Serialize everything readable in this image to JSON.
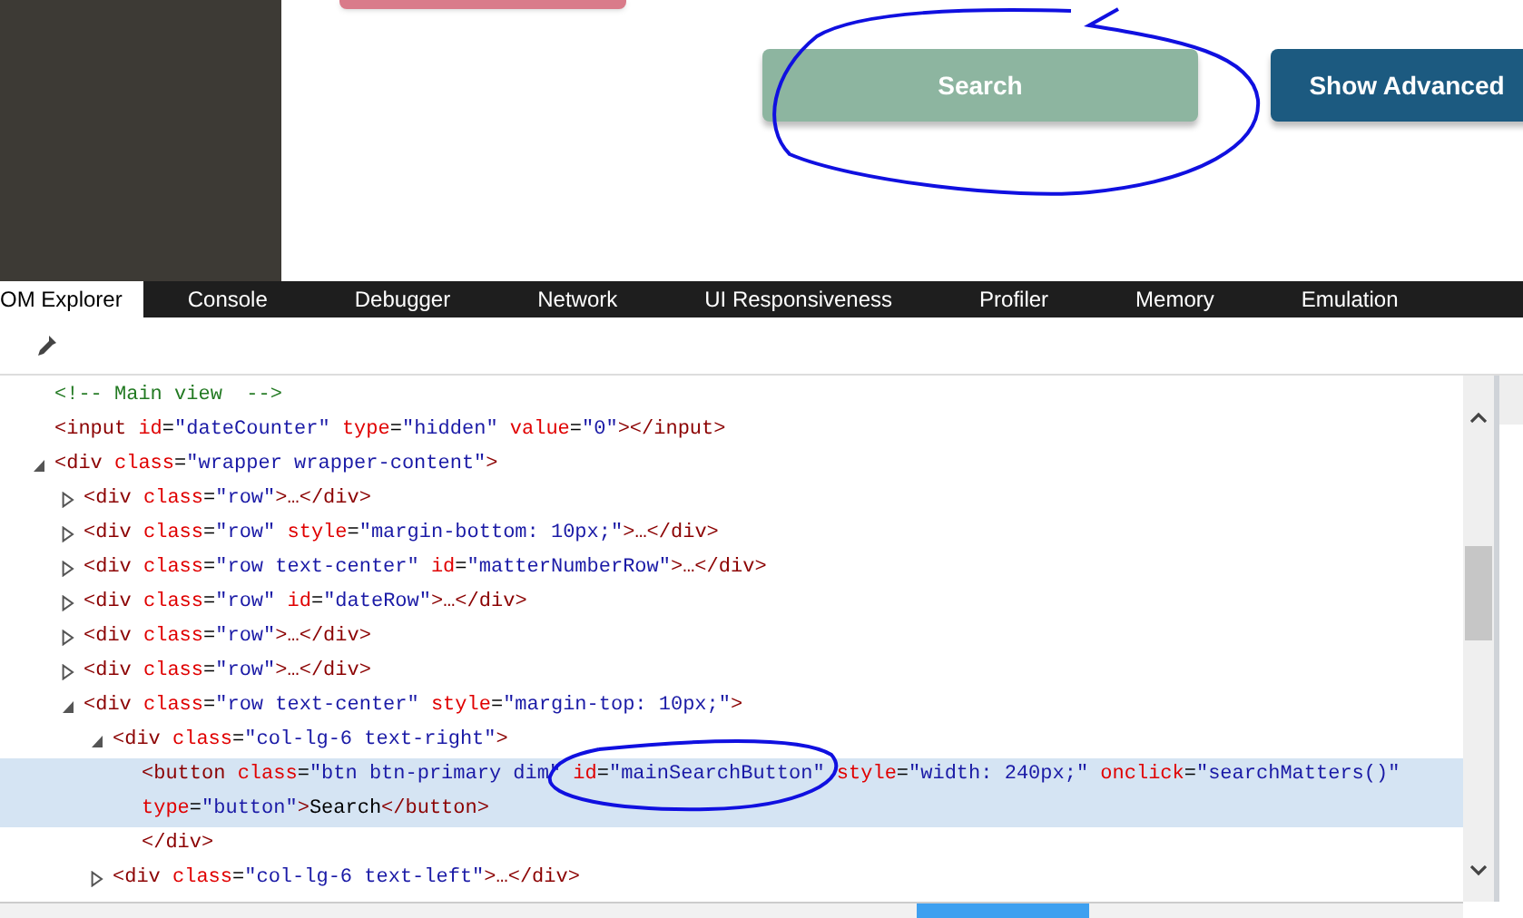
{
  "page": {
    "buttons": [
      {
        "label": "Search",
        "kind": "muted"
      },
      {
        "label": "Show Advanced",
        "kind": "dark"
      }
    ]
  },
  "devtools": {
    "tabs": [
      {
        "label": "OM Explorer",
        "selected": true
      },
      {
        "label": "Console",
        "selected": false
      },
      {
        "label": "Debugger",
        "selected": false
      },
      {
        "label": "Network",
        "selected": false
      },
      {
        "label": "UI Responsiveness",
        "selected": false
      },
      {
        "label": "Profiler",
        "selected": false
      },
      {
        "label": "Memory",
        "selected": false
      },
      {
        "label": "Emulation",
        "selected": false
      }
    ],
    "dom_tree": [
      {
        "selected": false,
        "tokens": [
          {
            "kind": "comment",
            "text": "<!-- Main view  -->"
          }
        ]
      },
      {
        "selected": false,
        "tokens": [
          {
            "kind": "tag",
            "text": "<input"
          },
          {
            "kind": "attr",
            "text": " id"
          },
          {
            "kind": "punct",
            "text": "="
          },
          {
            "kind": "value",
            "text": "\"dateCounter\""
          },
          {
            "kind": "attr",
            "text": " type"
          },
          {
            "kind": "punct",
            "text": "="
          },
          {
            "kind": "value",
            "text": "\"hidden\""
          },
          {
            "kind": "attr",
            "text": " value"
          },
          {
            "kind": "punct",
            "text": "="
          },
          {
            "kind": "value",
            "text": "\"0\""
          },
          {
            "kind": "tag",
            "text": "></input>"
          }
        ]
      },
      {
        "selected": false,
        "expanded": true,
        "tokens": [
          {
            "kind": "tag",
            "text": "<div"
          },
          {
            "kind": "attr",
            "text": " class"
          },
          {
            "kind": "punct",
            "text": "="
          },
          {
            "kind": "value",
            "text": "\"wrapper wrapper-content\""
          },
          {
            "kind": "tag",
            "text": ">"
          }
        ],
        "children": [
          {
            "selected": false,
            "expanded": false,
            "tokens": [
              {
                "kind": "tag",
                "text": "<div"
              },
              {
                "kind": "attr",
                "text": " class"
              },
              {
                "kind": "punct",
                "text": "="
              },
              {
                "kind": "value",
                "text": "\"row\""
              },
              {
                "kind": "tag",
                "text": ">…</div>"
              }
            ]
          },
          {
            "selected": false,
            "expanded": false,
            "tokens": [
              {
                "kind": "tag",
                "text": "<div"
              },
              {
                "kind": "attr",
                "text": " class"
              },
              {
                "kind": "punct",
                "text": "="
              },
              {
                "kind": "value",
                "text": "\"row\""
              },
              {
                "kind": "attr",
                "text": " style"
              },
              {
                "kind": "punct",
                "text": "="
              },
              {
                "kind": "value",
                "text": "\"margin-bottom: 10px;\""
              },
              {
                "kind": "tag",
                "text": ">…</div>"
              }
            ]
          },
          {
            "selected": false,
            "expanded": false,
            "tokens": [
              {
                "kind": "tag",
                "text": "<div"
              },
              {
                "kind": "attr",
                "text": " class"
              },
              {
                "kind": "punct",
                "text": "="
              },
              {
                "kind": "value",
                "text": "\"row text-center\""
              },
              {
                "kind": "attr",
                "text": " id"
              },
              {
                "kind": "punct",
                "text": "="
              },
              {
                "kind": "value",
                "text": "\"matterNumberRow\""
              },
              {
                "kind": "tag",
                "text": ">…</div>"
              }
            ]
          },
          {
            "selected": false,
            "expanded": false,
            "tokens": [
              {
                "kind": "tag",
                "text": "<div"
              },
              {
                "kind": "attr",
                "text": " class"
              },
              {
                "kind": "punct",
                "text": "="
              },
              {
                "kind": "value",
                "text": "\"row\""
              },
              {
                "kind": "attr",
                "text": " id"
              },
              {
                "kind": "punct",
                "text": "="
              },
              {
                "kind": "value",
                "text": "\"dateRow\""
              },
              {
                "kind": "tag",
                "text": ">…</div>"
              }
            ]
          },
          {
            "selected": false,
            "expanded": false,
            "tokens": [
              {
                "kind": "tag",
                "text": "<div"
              },
              {
                "kind": "attr",
                "text": " class"
              },
              {
                "kind": "punct",
                "text": "="
              },
              {
                "kind": "value",
                "text": "\"row\""
              },
              {
                "kind": "tag",
                "text": ">…</div>"
              }
            ]
          },
          {
            "selected": false,
            "expanded": false,
            "tokens": [
              {
                "kind": "tag",
                "text": "<div"
              },
              {
                "kind": "attr",
                "text": " class"
              },
              {
                "kind": "punct",
                "text": "="
              },
              {
                "kind": "value",
                "text": "\"row\""
              },
              {
                "kind": "tag",
                "text": ">…</div>"
              }
            ]
          },
          {
            "selected": false,
            "expanded": true,
            "tokens": [
              {
                "kind": "tag",
                "text": "<div"
              },
              {
                "kind": "attr",
                "text": " class"
              },
              {
                "kind": "punct",
                "text": "="
              },
              {
                "kind": "value",
                "text": "\"row text-center\""
              },
              {
                "kind": "attr",
                "text": " style"
              },
              {
                "kind": "punct",
                "text": "="
              },
              {
                "kind": "value",
                "text": "\"margin-top: 10px;\""
              },
              {
                "kind": "tag",
                "text": ">"
              }
            ],
            "children": [
              {
                "selected": false,
                "expanded": true,
                "tokens": [
                  {
                    "kind": "tag",
                    "text": "<div"
                  },
                  {
                    "kind": "attr",
                    "text": " class"
                  },
                  {
                    "kind": "punct",
                    "text": "="
                  },
                  {
                    "kind": "value",
                    "text": "\"col-lg-6 text-right\""
                  },
                  {
                    "kind": "tag",
                    "text": ">"
                  }
                ],
                "children": [
                  {
                    "selected": true,
                    "tokens": [
                      {
                        "kind": "tag",
                        "text": "<button"
                      },
                      {
                        "kind": "attr",
                        "text": " class"
                      },
                      {
                        "kind": "punct",
                        "text": "="
                      },
                      {
                        "kind": "value",
                        "text": "\"btn btn-primary dim\""
                      },
                      {
                        "kind": "attr",
                        "text": " id"
                      },
                      {
                        "kind": "punct",
                        "text": "="
                      },
                      {
                        "kind": "value",
                        "text": "\"mainSearchButton\""
                      },
                      {
                        "kind": "attr",
                        "text": " style"
                      },
                      {
                        "kind": "punct",
                        "text": "="
                      },
                      {
                        "kind": "value",
                        "text": "\"width: 240px;\""
                      },
                      {
                        "kind": "attr",
                        "text": " onclick"
                      },
                      {
                        "kind": "punct",
                        "text": "="
                      },
                      {
                        "kind": "value",
                        "text": "\"searchMatters()\""
                      },
                      {
                        "kind": "attr",
                        "text": "type",
                        "wrap": true
                      },
                      {
                        "kind": "punct",
                        "text": "="
                      },
                      {
                        "kind": "value",
                        "text": "\"button\""
                      },
                      {
                        "kind": "tag",
                        "text": ">"
                      },
                      {
                        "kind": "text",
                        "text": "Search"
                      },
                      {
                        "kind": "tag",
                        "text": "</button>"
                      }
                    ]
                  },
                  {
                    "selected": false,
                    "tokens": [
                      {
                        "kind": "tag",
                        "text": "</div>"
                      }
                    ]
                  }
                ]
              },
              {
                "selected": false,
                "expanded": false,
                "tokens": [
                  {
                    "kind": "tag",
                    "text": "<div"
                  },
                  {
                    "kind": "attr",
                    "text": " class"
                  },
                  {
                    "kind": "punct",
                    "text": "="
                  },
                  {
                    "kind": "value",
                    "text": "\"col-lg-6 text-left\""
                  },
                  {
                    "kind": "tag",
                    "text": ">…</div>"
                  }
                ]
              }
            ]
          }
        ]
      }
    ]
  }
}
